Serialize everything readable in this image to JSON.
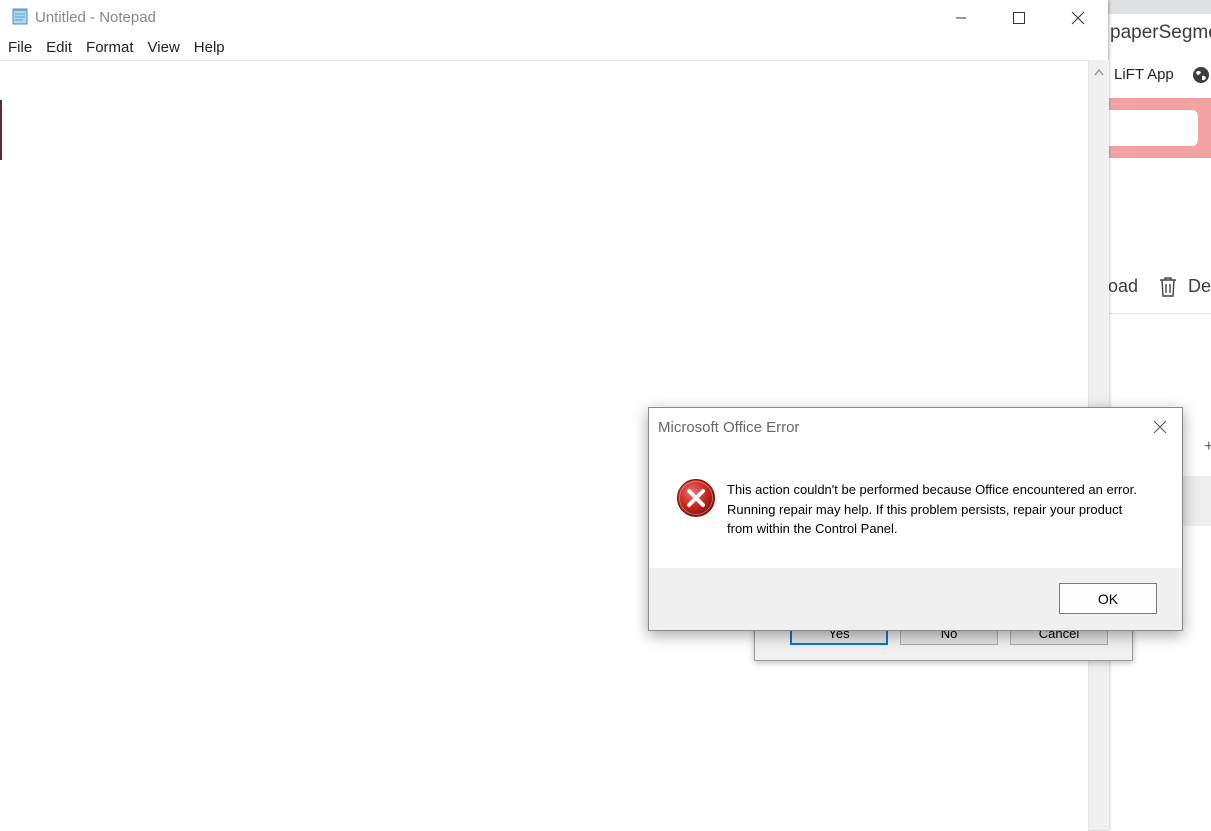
{
  "notepad": {
    "title": "Untitled - Notepad",
    "menu": [
      "File",
      "Edit",
      "Format",
      "View",
      "Help"
    ],
    "icons": {
      "app": "notepad-icon",
      "minimize": "minimize-icon",
      "maximize": "maximize-icon",
      "close": "close-icon",
      "scroll_up": "chevron-up-icon"
    }
  },
  "background_browser": {
    "tab_text": "paperSegmen",
    "bookmark": "LiFT App",
    "toolbar_load": "oad",
    "toolbar_delete": "De",
    "plus": "+",
    "banner_color": "#f4a3a3",
    "icons": {
      "globe": "globe-icon",
      "trash": "trash-icon"
    }
  },
  "under_dialog": {
    "buttons": {
      "yes": "Yes",
      "no": "No",
      "cancel": "Cancel"
    }
  },
  "error_dialog": {
    "title": "Microsoft Office Error",
    "message": "This action couldn't be performed because Office encountered an error. Running repair may help. If this problem persists, repair your product from within the Control Panel.",
    "ok_label": "OK",
    "icons": {
      "error": "error-icon",
      "close": "close-icon"
    },
    "accent": "#c42b1c"
  }
}
